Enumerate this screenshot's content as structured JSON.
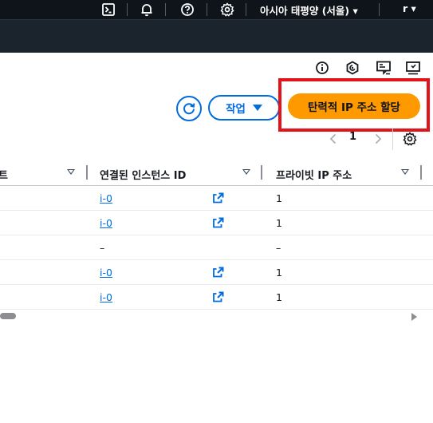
{
  "topnav": {
    "icons": [
      "cloudshell-icon",
      "bell-icon",
      "help-icon",
      "gear-icon"
    ],
    "region_label": "아시아 태평양 (서울)",
    "account_label": "r"
  },
  "utility_icons": [
    "info-icon",
    "hexagon-status-icon",
    "feedback-icon",
    "screen-icon"
  ],
  "toolbar": {
    "actions_label": "작업",
    "allocate_label": "탄력적 IP 주소 할당"
  },
  "pagination": {
    "current_page": "1"
  },
  "table": {
    "columns": [
      "트",
      "연결된 인스턴스 ID",
      "프라이빗 IP 주소"
    ],
    "rows": [
      {
        "instance": "i-0",
        "ext": true,
        "private_ip": "1"
      },
      {
        "instance": "i-0",
        "ext": true,
        "private_ip": "1"
      },
      {
        "instance": "–",
        "ext": false,
        "private_ip": "–"
      },
      {
        "instance": "i-0",
        "ext": true,
        "private_ip": "1"
      },
      {
        "instance": "i-0",
        "ext": true,
        "private_ip": "1"
      }
    ]
  },
  "colors": {
    "nav_bg": "#0f141a",
    "subnav_bg": "#1b232d",
    "link": "#006ce0",
    "primary_button": "#ff9900",
    "highlight": "#e3131b"
  }
}
